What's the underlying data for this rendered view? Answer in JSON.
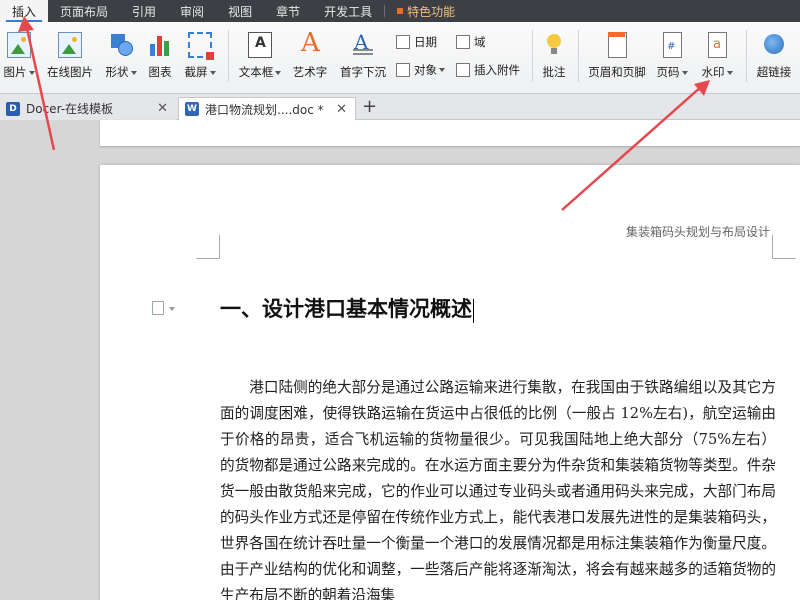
{
  "menubar": {
    "items": [
      {
        "label": "插入",
        "active": true
      },
      {
        "label": "页面布局"
      },
      {
        "label": "引用"
      },
      {
        "label": "审阅"
      },
      {
        "label": "视图"
      },
      {
        "label": "章节"
      },
      {
        "label": "开发工具"
      }
    ],
    "special": "特色功能"
  },
  "ribbon": {
    "picture": "图片",
    "online_picture": "在线图片",
    "shape": "形状",
    "chart": "图表",
    "screenshot": "截屏",
    "textbox": "文本框",
    "wordart": "艺术字",
    "dropcap": "首字下沉",
    "date": "日期",
    "object": "对象",
    "field": "域",
    "insert_attachment": "插入附件",
    "comment": "批注",
    "header_footer": "页眉和页脚",
    "page_number": "页码",
    "watermark": "水印",
    "hyperlink": "超链接"
  },
  "tabs": [
    {
      "label": "Docer-在线模板",
      "icon": "D"
    },
    {
      "label": "港口物流规划....doc *",
      "icon": "W"
    }
  ],
  "document": {
    "header_text": "集装箱码头规划与布局设计",
    "heading": "一、设计港口基本情况概述",
    "paragraph": "港口陆侧的绝大部分是通过公路运输来进行集散，在我国由于铁路编组以及其它方面的调度困难，使得铁路运输在货运中占很低的比例（一般占 12%左右)，航空运输由于价格的昂贵，适合飞机运输的货物量很少。可见我国陆地上绝大部分（75%左右）的货物都是通过公路来完成的。在水运方面主要分为件杂货和集装箱货物等类型。件杂货一般由散货船来完成，它的作业可以通过专业码头或者通用码头来完成，大部门布局的码头作业方式还是停留在传统作业方式上，能代表港口发展先进性的是集装箱码头，世界各国在统计吞吐量一个衡量一个港口的发展情况都是用标注集装箱作为衡量尺度。由于产业结构的优化和调整，一些落后产能将逐渐淘汰，将会有越来越多的适箱货物的生产布局不断的朝着沿海集"
  },
  "colors": {
    "menubar_bg": "#3c3f44",
    "accent": "#3b7bd4",
    "arrow": "#e5484d"
  }
}
